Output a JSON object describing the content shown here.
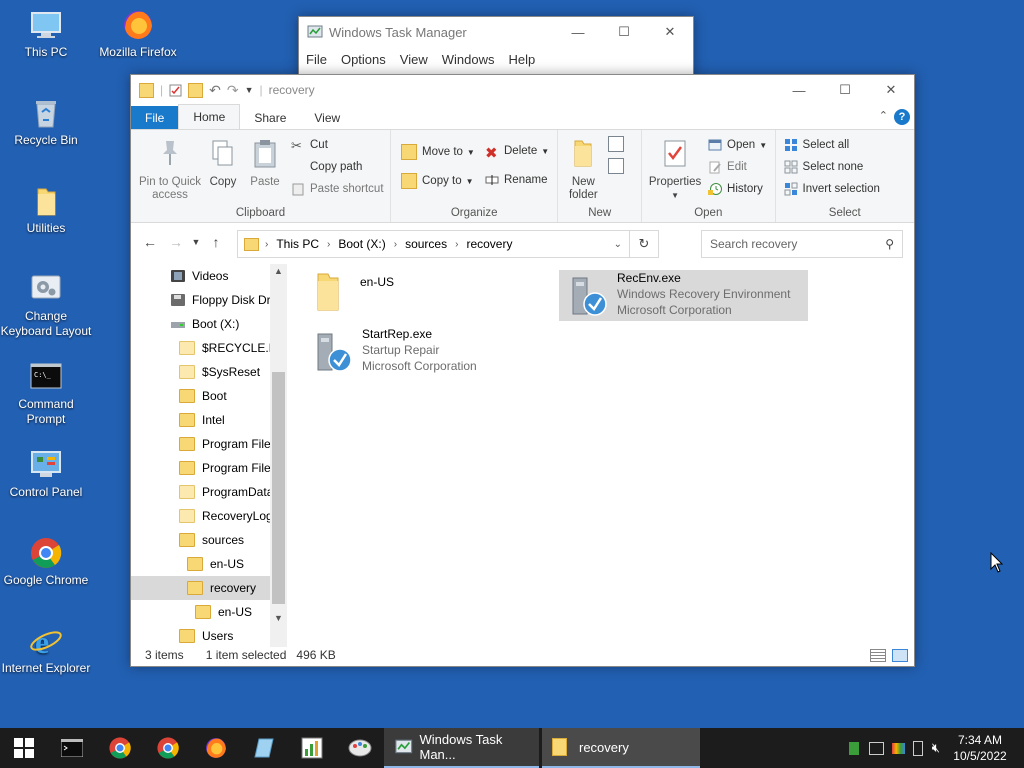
{
  "desktop": {
    "icons": [
      {
        "label": "This PC",
        "icon": "this-pc-icon"
      },
      {
        "label": "Mozilla Firefox",
        "icon": "firefox-icon"
      },
      {
        "label": "Recycle Bin",
        "icon": "recycle-bin-icon"
      },
      {
        "label": "Utilities",
        "icon": "folder-icon"
      },
      {
        "label": "Change Keyboard Layout",
        "icon": "keyboard-layout-icon"
      },
      {
        "label": "Command Prompt",
        "icon": "command-prompt-icon"
      },
      {
        "label": "Control Panel",
        "icon": "control-panel-icon"
      },
      {
        "label": "Google Chrome",
        "icon": "chrome-icon"
      },
      {
        "label": "Internet Explorer",
        "icon": "internet-explorer-icon"
      }
    ]
  },
  "task_manager": {
    "title": "Windows Task Manager",
    "menu": [
      "File",
      "Options",
      "View",
      "Windows",
      "Help"
    ]
  },
  "explorer": {
    "title": "recovery",
    "tabs": {
      "file": "File",
      "home": "Home",
      "share": "Share",
      "view": "View"
    },
    "ribbon": {
      "clipboard": {
        "label": "Clipboard",
        "pin_line1": "Pin to Quick",
        "pin_line2": "access",
        "copy": "Copy",
        "paste": "Paste",
        "cut": "Cut",
        "copy_path": "Copy path",
        "paste_shortcut": "Paste shortcut"
      },
      "organize": {
        "label": "Organize",
        "move_to": "Move to",
        "copy_to": "Copy to",
        "delete": "Delete",
        "rename": "Rename"
      },
      "new": {
        "label": "New",
        "new_folder_line1": "New",
        "new_folder_line2": "folder"
      },
      "open": {
        "label": "Open",
        "properties": "Properties",
        "open": "Open",
        "edit": "Edit",
        "history": "History"
      },
      "select": {
        "label": "Select",
        "select_all": "Select all",
        "select_none": "Select none",
        "invert_selection": "Invert selection"
      }
    },
    "address": {
      "crumbs": [
        "This PC",
        "Boot (X:)",
        "sources",
        "recovery"
      ],
      "search_placeholder": "Search recovery"
    },
    "nav": [
      {
        "label": "Videos"
      },
      {
        "label": "Floppy Disk Dri"
      },
      {
        "label": "Boot (X:)"
      },
      {
        "label": "$RECYCLE.BIN"
      },
      {
        "label": "$SysReset"
      },
      {
        "label": "Boot"
      },
      {
        "label": "Intel"
      },
      {
        "label": "Program Files"
      },
      {
        "label": "Program Files"
      },
      {
        "label": "ProgramData"
      },
      {
        "label": "RecoveryLogs"
      },
      {
        "label": "sources"
      },
      {
        "label": "en-US"
      },
      {
        "label": "recovery"
      },
      {
        "label": "en-US"
      },
      {
        "label": "Users"
      }
    ],
    "files": [
      {
        "name": "en-US",
        "line2": "",
        "line3": ""
      },
      {
        "name": "RecEnv.exe",
        "line2": "Windows Recovery Environment",
        "line3": "Microsoft Corporation"
      },
      {
        "name": "StartRep.exe",
        "line2": "Startup Repair",
        "line3": "Microsoft Corporation"
      }
    ],
    "status": {
      "count": "3 items",
      "selected": "1 item selected",
      "size": "496 KB"
    }
  },
  "taskbar": {
    "apps": [
      {
        "label": "Windows Task Man..."
      },
      {
        "label": "recovery"
      }
    ],
    "time": "7:34 AM",
    "date": "10/5/2022"
  },
  "colors": {
    "desktop": "#2260b3",
    "file_tab": "#1979ca",
    "taskbar": "#1c1c1c",
    "selection": "#d9d9d9"
  }
}
